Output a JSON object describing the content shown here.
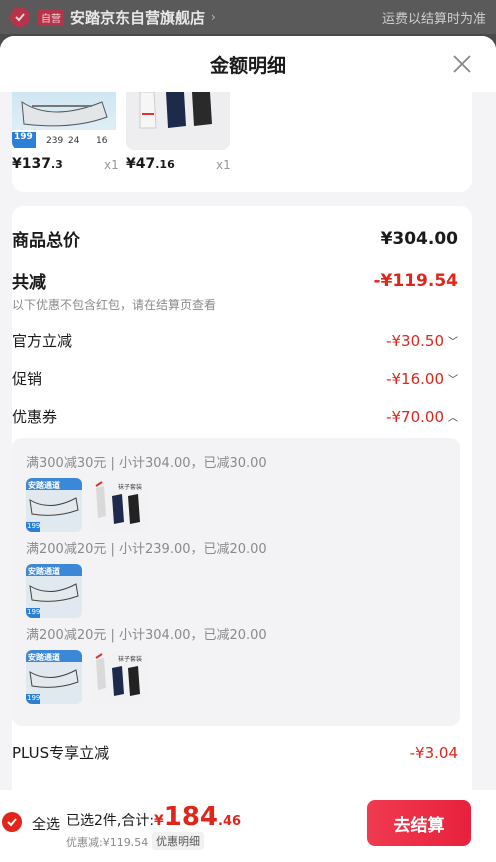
{
  "store": {
    "badge": "自营",
    "name": "安踏京东自营旗舰店",
    "arrow": "›",
    "note": "运费以结算时为准"
  },
  "sheet": {
    "title": "金额明细"
  },
  "products": [
    {
      "tag": "199",
      "nums": [
        "239",
        "24",
        "16"
      ],
      "price_int": "¥137",
      "price_dec": ".3",
      "qty": "x1"
    },
    {
      "price_int": "¥47",
      "price_dec": ".16",
      "qty": "x1"
    }
  ],
  "summary": {
    "goods_label": "商品总价",
    "goods_value": "¥304.00",
    "reduce_label": "共减",
    "reduce_value": "-¥119.54",
    "reduce_note": "以下优惠不包含红包，请在结算页查看",
    "official_label": "官方立减",
    "official_value": "-¥30.50",
    "promo_label": "促销",
    "promo_value": "-¥16.00",
    "coupon_label": "优惠券",
    "coupon_value": "-¥70.00",
    "plus_label": "PLUS专享立减",
    "plus_value": "-¥3.04"
  },
  "coupons": [
    {
      "text": "满300减30元 | 小计304.00，已减30.00"
    },
    {
      "text": "满200减20元 | 小计239.00，已减20.00"
    },
    {
      "text": "满200减20元 | 小计304.00，已减20.00"
    }
  ],
  "shoe_thumb": {
    "banner": "安踏通道",
    "tag": "199"
  },
  "sock_thumb": {
    "label": "袜子套装"
  },
  "bottom": {
    "select_all": "全选",
    "selected": "已选2件,合计:",
    "currency": "¥",
    "total_int": "184",
    "total_dec": ".46",
    "saved": "优惠减:¥119.54",
    "detail": "优惠明细",
    "checkout": "去结算"
  },
  "colors": {
    "accent": "#e1251b",
    "button": "#ec2d45"
  }
}
